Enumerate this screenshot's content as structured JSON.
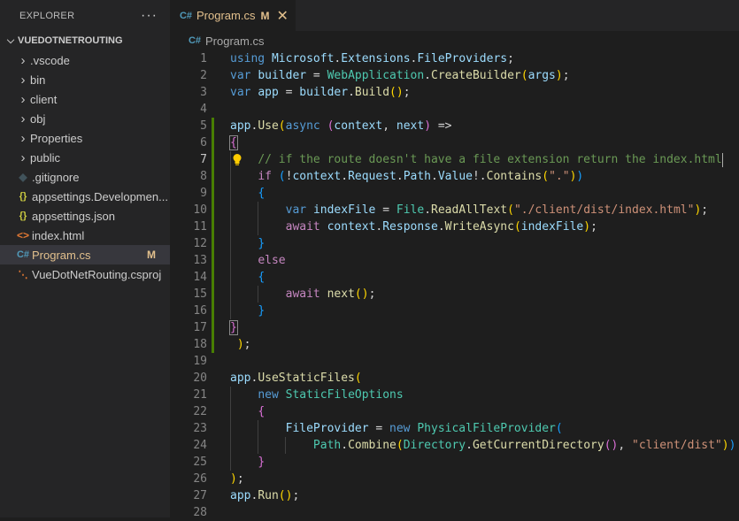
{
  "explorer": {
    "title": "EXPLORER",
    "more": "···",
    "root": "VUEDOTNETROUTING",
    "items": [
      {
        "label": ".vscode",
        "kind": "folder"
      },
      {
        "label": "bin",
        "kind": "folder"
      },
      {
        "label": "client",
        "kind": "folder"
      },
      {
        "label": "obj",
        "kind": "folder"
      },
      {
        "label": "Properties",
        "kind": "folder"
      },
      {
        "label": "public",
        "kind": "folder"
      },
      {
        "label": ".gitignore",
        "kind": "file",
        "icon": "git-icon"
      },
      {
        "label": "appsettings.Developmen...",
        "kind": "file",
        "icon": "json-icon"
      },
      {
        "label": "appsettings.json",
        "kind": "file",
        "icon": "json-icon"
      },
      {
        "label": "index.html",
        "kind": "file",
        "icon": "html-icon"
      },
      {
        "label": "Program.cs",
        "kind": "file",
        "icon": "csharp-icon",
        "badge": "M",
        "selected": true
      },
      {
        "label": "VueDotNetRouting.csproj",
        "kind": "file",
        "icon": "rss-icon"
      }
    ]
  },
  "tab": {
    "label": "Program.cs",
    "modified": "M",
    "close": "✕"
  },
  "breadcrumb": {
    "file": "Program.cs"
  },
  "code": {
    "active_line": 7,
    "lines": [
      {
        "n": "1",
        "t": "using Microsoft.Extensions.FileProviders;"
      },
      {
        "n": "2",
        "t": "var builder = WebApplication.CreateBuilder(args);"
      },
      {
        "n": "3",
        "t": "var app = builder.Build();"
      },
      {
        "n": "4",
        "t": ""
      },
      {
        "n": "5",
        "t": "app.Use(async (context, next) =>"
      },
      {
        "n": "6",
        "t": "{"
      },
      {
        "n": "7",
        "t": "    // if the route doesn't have a file extension return the index.html"
      },
      {
        "n": "8",
        "t": "    if (!context.Request.Path.Value!.Contains(\".\"))"
      },
      {
        "n": "9",
        "t": "    {"
      },
      {
        "n": "10",
        "t": "        var indexFile = File.ReadAllText(\"./client/dist/index.html\");"
      },
      {
        "n": "11",
        "t": "        await context.Response.WriteAsync(indexFile);"
      },
      {
        "n": "12",
        "t": "    }"
      },
      {
        "n": "13",
        "t": "    else"
      },
      {
        "n": "14",
        "t": "    {"
      },
      {
        "n": "15",
        "t": "        await next();"
      },
      {
        "n": "16",
        "t": "    }"
      },
      {
        "n": "17",
        "t": "}"
      },
      {
        "n": "18",
        "t": " );"
      },
      {
        "n": "19",
        "t": ""
      },
      {
        "n": "20",
        "t": "app.UseStaticFiles("
      },
      {
        "n": "21",
        "t": "    new StaticFileOptions"
      },
      {
        "n": "22",
        "t": "    {"
      },
      {
        "n": "23",
        "t": "        FileProvider = new PhysicalFileProvider("
      },
      {
        "n": "24",
        "t": "            Path.Combine(Directory.GetCurrentDirectory(), \"client/dist\"))"
      },
      {
        "n": "25",
        "t": "    }"
      },
      {
        "n": "26",
        "t": ");"
      },
      {
        "n": "27",
        "t": "app.Run();"
      },
      {
        "n": "28",
        "t": ""
      }
    ]
  },
  "colors": {
    "sidebar_bg": "#252526",
    "editor_bg": "#1e1e1e",
    "modified": "#e2c08d",
    "keyword": "#569cd6",
    "type": "#4ec9b0",
    "function": "#dcdcaa",
    "string": "#ce9178",
    "comment": "#6a9955",
    "gutter_change": "#487e02"
  }
}
